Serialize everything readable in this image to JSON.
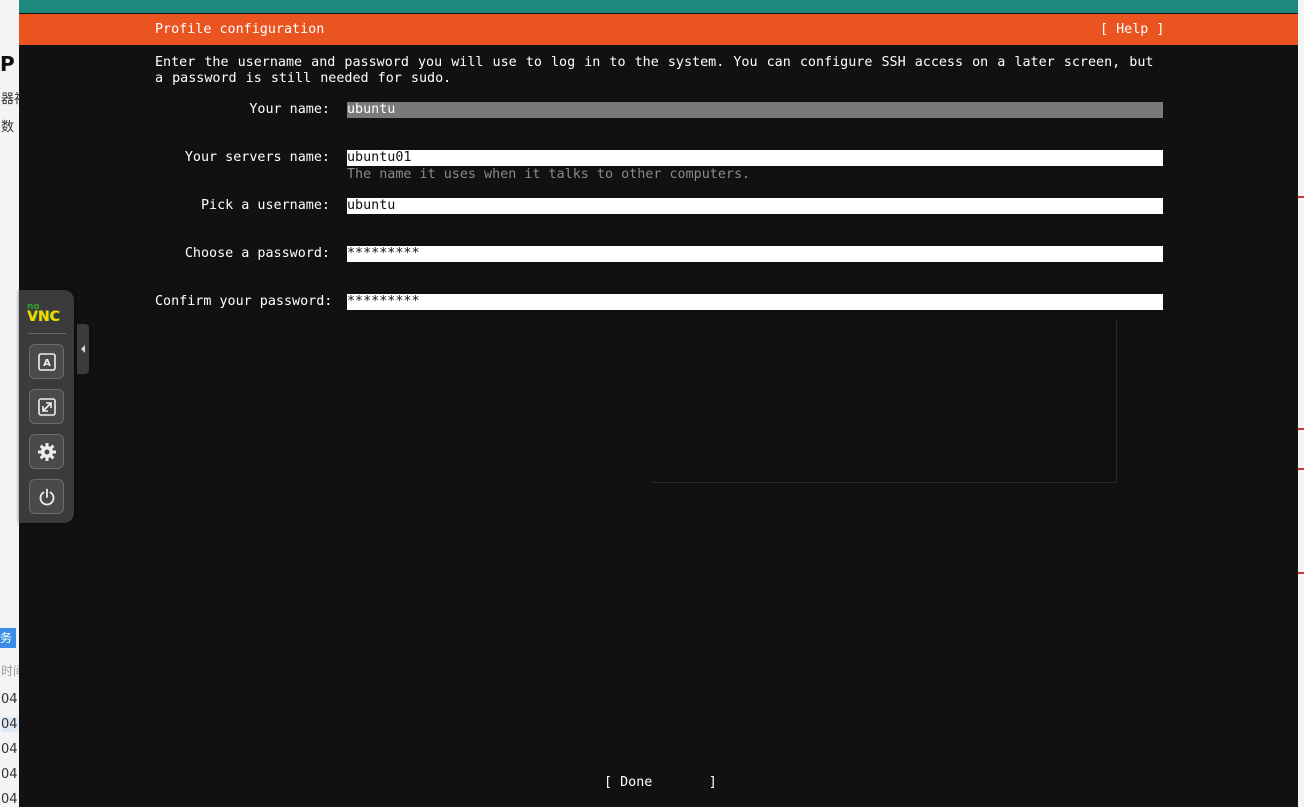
{
  "background_app": {
    "left_fragments": [
      "P",
      "器视",
      "数",
      "务",
      "时间",
      "04",
      "04",
      "04",
      "04",
      "04"
    ]
  },
  "header": {
    "title": "Profile configuration",
    "help": "[ Help ]"
  },
  "intro": "Enter the username and password you will use to log in to the system. You can configure SSH access on a later screen, but a password is still needed for sudo.",
  "form": {
    "your_name": {
      "label": "Your name:",
      "value": "ubuntu"
    },
    "server_name": {
      "label": "Your servers name:",
      "value": "ubuntu01",
      "hint": "The name it uses when it talks to other computers."
    },
    "username": {
      "label": "Pick a username:",
      "value": "ubuntu"
    },
    "password": {
      "label": "Choose a password:",
      "value": "*********"
    },
    "confirm_password": {
      "label": "Confirm your password:",
      "value": "*********"
    }
  },
  "done_button": "[ Done       ]",
  "novnc": {
    "logo_no": "no",
    "logo_vnc": "VNC",
    "buttons": [
      "keyboard-icon",
      "fullscreen-icon",
      "gear-icon",
      "power-icon"
    ]
  },
  "colors": {
    "accent": "#e95420",
    "terminal_bg": "#111111",
    "focused_field": "#7a7a7a"
  }
}
